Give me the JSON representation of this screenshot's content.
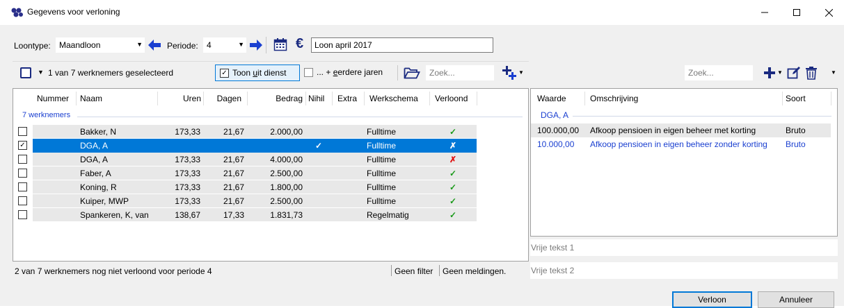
{
  "window": {
    "title": "Gegevens voor verloning"
  },
  "toolbar": {
    "loontype_label": "Loontype:",
    "loontype_value": "Maandloon",
    "periode_label": "Periode:",
    "periode_value": "4",
    "description_value": "Loon april 2017"
  },
  "left": {
    "selection_text": "1 van 7 werknemers geselecteerd",
    "toon_uit_dienst_pre": "Toon ",
    "toon_uit_dienst_u": "u",
    "toon_uit_dienst_post": "it dienst",
    "eerdere_jaren_pre": "... + ",
    "eerdere_jaren_u": "e",
    "eerdere_jaren_post": "erdere jaren",
    "search_placeholder": "Zoek...",
    "columns": [
      "Nummer",
      "Naam",
      "Uren",
      "Dagen",
      "Bedrag",
      "Nihil",
      "Extra",
      "Werkschema",
      "Verloond"
    ],
    "group_label": "7 werknemers",
    "rows": [
      {
        "checked": false,
        "nummer": "",
        "naam": "Bakker, N",
        "uren": "173,33",
        "dagen": "21,67",
        "bedrag": "2.000,00",
        "nihil": "",
        "extra": "",
        "werkschema": "Fulltime",
        "verloond": "✓",
        "status": "ok"
      },
      {
        "checked": true,
        "nummer": "",
        "naam": "DGA, A",
        "uren": "",
        "dagen": "",
        "bedrag": "",
        "nihil": "✓",
        "extra": "",
        "werkschema": "Fulltime",
        "verloond": "✗",
        "status": "selected"
      },
      {
        "checked": false,
        "nummer": "",
        "naam": "DGA, A",
        "uren": "173,33",
        "dagen": "21,67",
        "bedrag": "4.000,00",
        "nihil": "",
        "extra": "",
        "werkschema": "Fulltime",
        "verloond": "✗",
        "status": "no"
      },
      {
        "checked": false,
        "nummer": "",
        "naam": "Faber, A",
        "uren": "173,33",
        "dagen": "21,67",
        "bedrag": "2.500,00",
        "nihil": "",
        "extra": "",
        "werkschema": "Fulltime",
        "verloond": "✓",
        "status": "ok"
      },
      {
        "checked": false,
        "nummer": "",
        "naam": "Koning, R",
        "uren": "173,33",
        "dagen": "21,67",
        "bedrag": "1.800,00",
        "nihil": "",
        "extra": "",
        "werkschema": "Fulltime",
        "verloond": "✓",
        "status": "ok"
      },
      {
        "checked": false,
        "nummer": "",
        "naam": "Kuiper, MWP",
        "uren": "173,33",
        "dagen": "21,67",
        "bedrag": "2.500,00",
        "nihil": "",
        "extra": "",
        "werkschema": "Fulltime",
        "verloond": "✓",
        "status": "ok"
      },
      {
        "checked": false,
        "nummer": "",
        "naam": "Spankeren, K, van",
        "uren": "138,67",
        "dagen": "17,33",
        "bedrag": "1.831,73",
        "nihil": "",
        "extra": "",
        "werkschema": "Regelmatig",
        "verloond": "✓",
        "status": "ok"
      }
    ],
    "status_text": "2 van 7 werknemers nog niet verloond voor periode 4",
    "filter_text": "Geen filter",
    "meldingen_text": "Geen meldingen."
  },
  "right": {
    "search_placeholder": "Zoek...",
    "columns": [
      "Waarde",
      "Omschrijving",
      "Soort"
    ],
    "group_label": "DGA, A",
    "rows": [
      {
        "waarde": "100.000,00",
        "omschrijving": "Afkoop pensioen in eigen beheer met korting",
        "soort": "Bruto",
        "highlight": false
      },
      {
        "waarde": "10.000,00",
        "omschrijving": "Afkoop pensioen in eigen beheer zonder korting",
        "soort": "Bruto",
        "highlight": true
      }
    ],
    "vrije_tekst_1": "Vrije tekst 1",
    "vrije_tekst_2": "Vrije tekst 2"
  },
  "buttons": {
    "verloon": "Verloon",
    "annuleer": "Annuleer"
  },
  "colors": {
    "selection": "#0078d7",
    "accent_blue": "#1a3fd0",
    "ok_green": "#1a9a1a",
    "no_red": "#e01010"
  }
}
